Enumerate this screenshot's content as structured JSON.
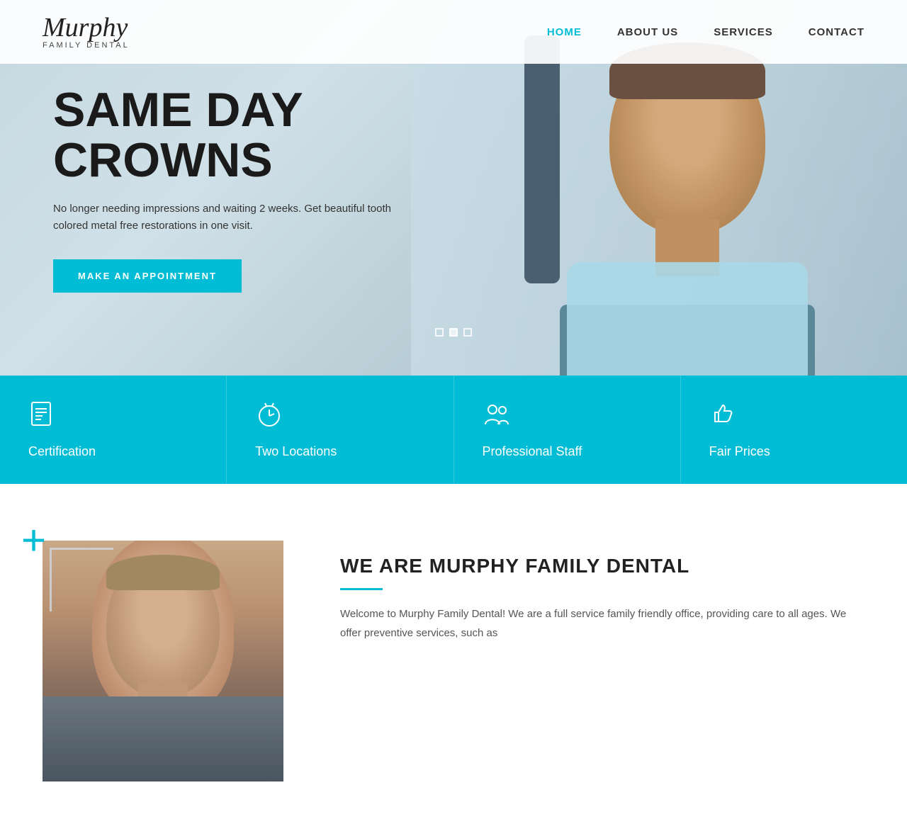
{
  "header": {
    "logo_script": "Murphy",
    "logo_sub": "Family Dental",
    "nav": [
      {
        "id": "home",
        "label": "HOME",
        "active": true
      },
      {
        "id": "about",
        "label": "ABOUT US",
        "active": false
      },
      {
        "id": "services",
        "label": "SERVICES",
        "active": false
      },
      {
        "id": "contact",
        "label": "CONTACT",
        "active": false
      }
    ]
  },
  "hero": {
    "title_line1": "SAME DAY",
    "title_line2": "CROWNS",
    "subtitle": "No longer needing impressions and waiting 2 weeks. Get beautiful tooth colored metal free restorations in one visit.",
    "cta_label": "MAKE AN APPOINTMENT",
    "dots": [
      {
        "active": false
      },
      {
        "active": true
      },
      {
        "active": false
      }
    ]
  },
  "features": [
    {
      "id": "certification",
      "icon": "📋",
      "label": "Certification"
    },
    {
      "id": "two-locations",
      "icon": "⏰",
      "label": "Two Locations"
    },
    {
      "id": "professional-staff",
      "icon": "👥",
      "label": "Professional Staff"
    },
    {
      "id": "fair-prices",
      "icon": "👍",
      "label": "Fair Prices"
    }
  ],
  "about": {
    "title": "WE ARE MURPHY FAMILY DENTAL",
    "text": "Welcome to Murphy Family Dental! We are a full service family friendly office, providing care to all ages. We offer preventive services, such as"
  }
}
